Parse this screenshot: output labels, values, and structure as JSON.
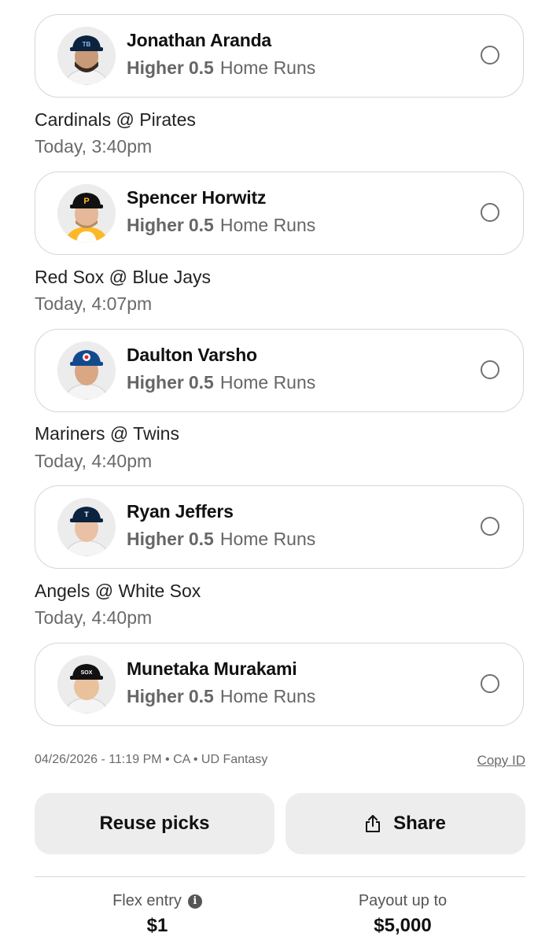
{
  "picks": [
    {
      "player": "Jonathan Aranda",
      "direction": "Higher",
      "line": "0.5",
      "stat": "Home Runs",
      "avatar_icon": "player-headshot-rays",
      "cap_color": "#0c2340",
      "cap_logo": "TB",
      "cap_logo_color": "#8fbce6"
    },
    {
      "matchup": "Cardinals @ Pirates",
      "time": "Today, 3:40pm",
      "player": "Spencer Horwitz",
      "direction": "Higher",
      "line": "0.5",
      "stat": "Home Runs",
      "avatar_icon": "player-headshot-pirates",
      "cap_color": "#111111",
      "cap_logo": "P",
      "cap_logo_color": "#fdb827"
    },
    {
      "matchup": "Red Sox @ Blue Jays",
      "time": "Today, 4:07pm",
      "player": "Daulton Varsho",
      "direction": "Higher",
      "line": "0.5",
      "stat": "Home Runs",
      "avatar_icon": "player-headshot-bluejays",
      "cap_color": "#134a8e",
      "cap_logo": "TOR",
      "cap_logo_color": "#e8291c"
    },
    {
      "matchup": "Mariners @ Twins",
      "time": "Today, 4:40pm",
      "player": "Ryan Jeffers",
      "direction": "Higher",
      "line": "0.5",
      "stat": "Home Runs",
      "avatar_icon": "player-headshot-twins",
      "cap_color": "#0c2340",
      "cap_logo": "TC",
      "cap_logo_color": "#ffffff"
    },
    {
      "matchup": "Angels @ White Sox",
      "time": "Today, 4:40pm",
      "player": "Munetaka Murakami",
      "direction": "Higher",
      "line": "0.5",
      "stat": "Home Runs",
      "avatar_icon": "player-headshot-whitesox",
      "cap_color": "#111111",
      "cap_logo": "SOX",
      "cap_logo_color": "#ffffff"
    }
  ],
  "entry_meta": "04/26/2026 - 11:19 PM • CA • UD Fantasy",
  "copy_id_label": "Copy ID",
  "buttons": {
    "reuse_label": "Reuse picks",
    "share_label": "Share",
    "share_icon": "share-icon"
  },
  "footer": {
    "entry_type_label": "Flex entry",
    "entry_amount": "$1",
    "info_icon": "info-icon",
    "payout_label": "Payout up to",
    "payout_amount": "$5,000"
  }
}
